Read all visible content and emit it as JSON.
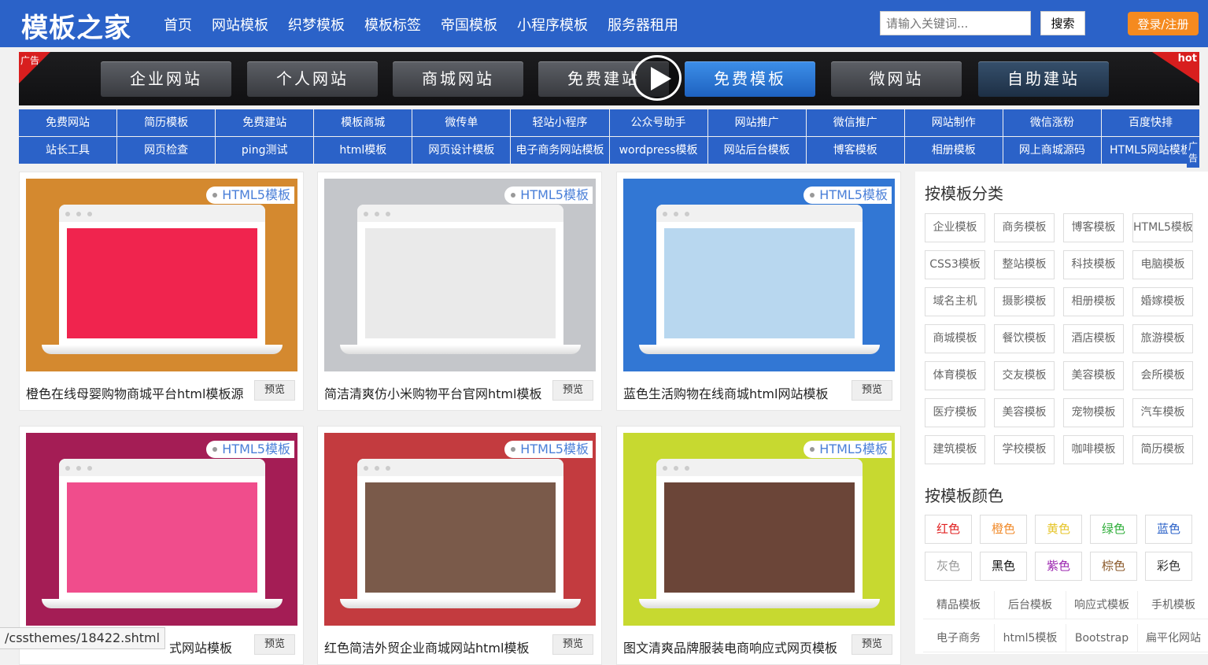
{
  "header": {
    "logo": "模板之家",
    "nav": [
      "首页",
      "网站模板",
      "织梦模板",
      "模板标签",
      "帝国模板",
      "小程序模板",
      "服务器租用"
    ],
    "search_placeholder": "请输入关键词...",
    "search_button": "搜索",
    "login_button": "登录/注册",
    "colors": {
      "primary": "#2b62c8",
      "login": "#f58a1f"
    }
  },
  "banner": {
    "ad_label": "广告",
    "hot_label": "hot",
    "buttons": [
      "企业网站",
      "个人网站",
      "商城网站",
      "免费建站",
      "免费模板",
      "微网站",
      "自助建站"
    ]
  },
  "links": {
    "row1": [
      "免费网站",
      "简历模板",
      "免费建站",
      "模板商城",
      "微传单",
      "轻站小程序",
      "公众号助手",
      "网站推广",
      "微信推广",
      "网站制作",
      "微信涨粉",
      "百度快排"
    ],
    "row2": [
      "站长工具",
      "网页检查",
      "ping测试",
      "html模板",
      "网页设计模板",
      "电子商务网站模板",
      "wordpress模板",
      "网站后台模板",
      "博客模板",
      "相册模板",
      "网上商城源码",
      "HTML5网站模板"
    ],
    "ad_side": "广告"
  },
  "cards": [
    {
      "tag": "HTML5模板",
      "title": "橙色在线母婴购物商城平台html模板源",
      "preview": "预览",
      "bg": "#d4892f",
      "screen": "#f0244e"
    },
    {
      "tag": "HTML5模板",
      "title": "简洁清爽仿小米购物平台官网html模板",
      "preview": "预览",
      "bg": "#c4c6ca",
      "screen": "#eaeaea"
    },
    {
      "tag": "HTML5模板",
      "title": "蓝色生活购物在线商城html网站模板",
      "preview": "预览",
      "bg": "#3277d4",
      "screen": "#b8d7ef"
    },
    {
      "tag": "HTML5模板",
      "title": "式网站模板",
      "preview": "预览",
      "bg": "#a41d55",
      "screen": "#f04d8c"
    },
    {
      "tag": "HTML5模板",
      "title": "红色简洁外贸企业商城网站html模板",
      "preview": "预览",
      "bg": "#c33b3f",
      "screen": "#7a5a4a"
    },
    {
      "tag": "HTML5模板",
      "title": "图文清爽品牌服装电商响应式网页模板",
      "preview": "预览",
      "bg": "#c7d930",
      "screen": "#6b4538"
    }
  ],
  "sidebar": {
    "category_title": "按模板分类",
    "categories": [
      "企业模板",
      "商务模板",
      "博客模板",
      "HTML5模板",
      "CSS3模板",
      "整站模板",
      "科技模板",
      "电脑模板",
      "域名主机",
      "摄影模板",
      "相册模板",
      "婚嫁模板",
      "商城模板",
      "餐饮模板",
      "酒店模板",
      "旅游模板",
      "体育模板",
      "交友模板",
      "美容模板",
      "会所模板",
      "医疗模板",
      "美容模板",
      "宠物模板",
      "汽车模板",
      "建筑模板",
      "学校模板",
      "咖啡模板",
      "简历模板"
    ],
    "color_title": "按模板颜色",
    "color_items": [
      {
        "label": "红色",
        "color": "#e02020"
      },
      {
        "label": "橙色",
        "color": "#f08a2a"
      },
      {
        "label": "黄色",
        "color": "#e6c52a"
      },
      {
        "label": "绿色",
        "color": "#2fae3a"
      },
      {
        "label": "蓝色",
        "color": "#2b62c8"
      },
      {
        "label": "灰色",
        "color": "#999999"
      },
      {
        "label": "黑色",
        "color": "#111111"
      },
      {
        "label": "紫色",
        "color": "#9c27b0"
      },
      {
        "label": "棕色",
        "color": "#8b5a2b"
      },
      {
        "label": "彩色",
        "color": "#333333"
      }
    ],
    "tags_row1": [
      "精品模板",
      "后台模板",
      "响应式模板",
      "手机模板"
    ],
    "tags_row2": [
      "电子商务",
      "html5模板",
      "Bootstrap",
      "扁平化网站"
    ]
  },
  "status_url": "/cssthemes/18422.shtml"
}
